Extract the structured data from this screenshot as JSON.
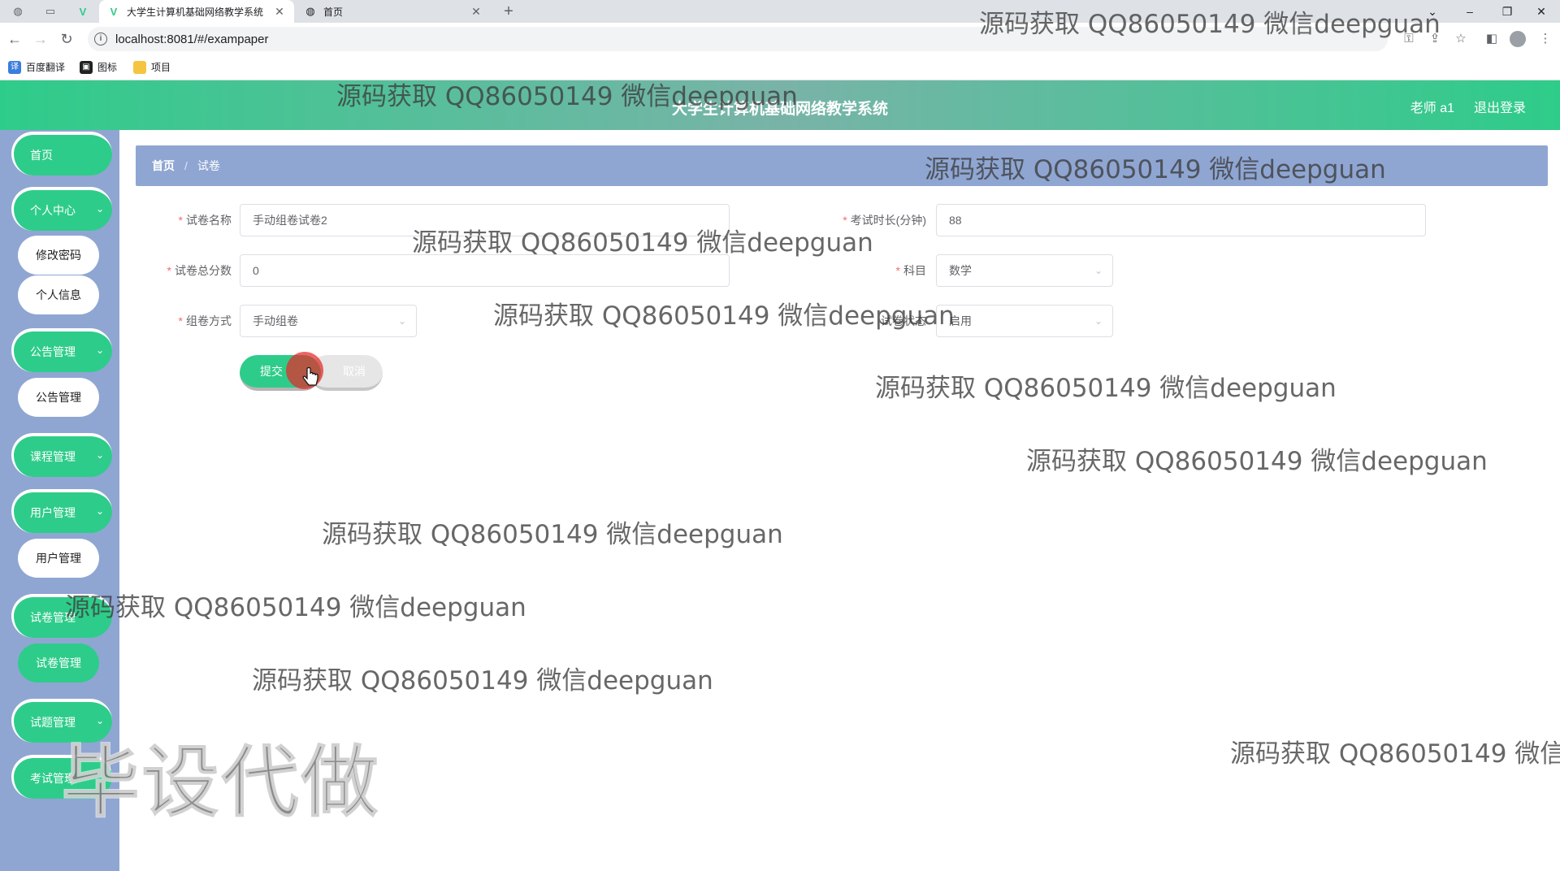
{
  "browser": {
    "tabs": [
      {
        "title": "大学生计算机基础网络教学系统",
        "active": true
      },
      {
        "title": "首页",
        "active": false
      }
    ],
    "url": "localhost:8081/#/exampaper",
    "bookmarks": [
      "百度翻译",
      "图标",
      "项目"
    ]
  },
  "header": {
    "title": "大学生计算机基础网络教学系统",
    "user": "老师 a1",
    "logout": "退出登录"
  },
  "sidebar": {
    "home": "首页",
    "personal_center": "个人中心",
    "change_password": "修改密码",
    "personal_info": "个人信息",
    "notice_mgmt": "公告管理",
    "notice_mgmt_sub": "公告管理",
    "course_mgmt": "课程管理",
    "user_mgmt": "用户管理",
    "user_mgmt_sub": "用户管理",
    "paper_mgmt": "试卷管理",
    "paper_mgmt_sub": "试卷管理",
    "question_mgmt": "试题管理",
    "exam_mgmt": "考试管理"
  },
  "breadcrumb": {
    "home": "首页",
    "current": "试卷"
  },
  "form": {
    "paper_name_label": "试卷名称",
    "paper_name_value": "手动组卷试卷2",
    "duration_label": "考试时长(分钟)",
    "duration_value": "88",
    "total_score_label": "试卷总分数",
    "total_score_value": "0",
    "subject_label": "科目",
    "subject_value": "数学",
    "method_label": "组卷方式",
    "method_value": "手动组卷",
    "status_label": "试卷状态",
    "status_value": "启用",
    "submit": "提交",
    "cancel": "取消"
  },
  "watermark": {
    "text": "源码获取 QQ86050149 微信deepguan",
    "text_cut": "源码获取 QQ86050149 微信d",
    "big": "毕设代做"
  },
  "colors": {
    "accent": "#2ecc8a",
    "sidebar": "#8fa6d2",
    "required": "#f56c6c"
  }
}
